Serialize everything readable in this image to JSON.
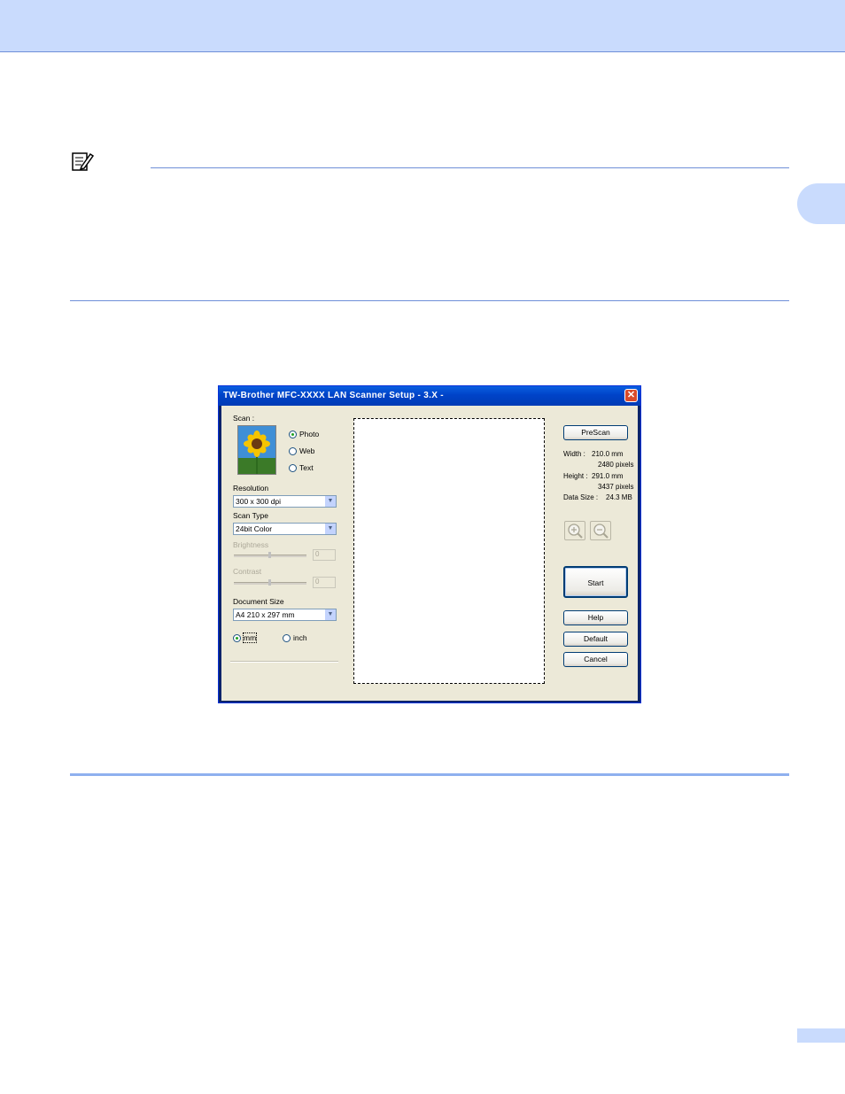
{
  "dialog": {
    "title": "TW-Brother MFC-XXXX   LAN Scanner Setup - 3.X -",
    "close_glyph": "✕",
    "scan_label": "Scan :",
    "scan_options": [
      "Photo",
      "Web",
      "Text"
    ],
    "selected_scan": "Photo",
    "resolution_label": "Resolution",
    "resolution_value": "300 x 300 dpi",
    "scan_type_label": "Scan Type",
    "scan_type_value": "24bit Color",
    "brightness_label": "Brightness",
    "brightness_value": "0",
    "contrast_label": "Contrast",
    "contrast_value": "0",
    "document_size_label": "Document Size",
    "document_size_value": "A4 210 x 297 mm",
    "unit_mm": "mm",
    "unit_inch": "inch",
    "selected_unit": "mm",
    "prescan_label": "PreScan",
    "width_label": "Width :",
    "width_mm": "210.0 mm",
    "width_pixels": "2480 pixels",
    "height_label": "Height :",
    "height_mm": "291.0 mm",
    "height_pixels": "3437 pixels",
    "data_size_label": "Data Size :",
    "data_size_value": "24.3 MB",
    "start_label": "Start",
    "help_label": "Help",
    "default_label": "Default",
    "cancel_label": "Cancel"
  },
  "icons": {
    "note": "note-pencil-icon",
    "zoom_in": "zoom-in-icon",
    "zoom_out": "zoom-out-icon",
    "dropdown": "chevron-down-icon",
    "photo": "sunflower-photo-icon"
  },
  "colors": {
    "header_band": "#c9dbfd",
    "rule": "#6f8fd8",
    "titlebar": "#0043c8",
    "dialog_body": "#ece9d8"
  }
}
